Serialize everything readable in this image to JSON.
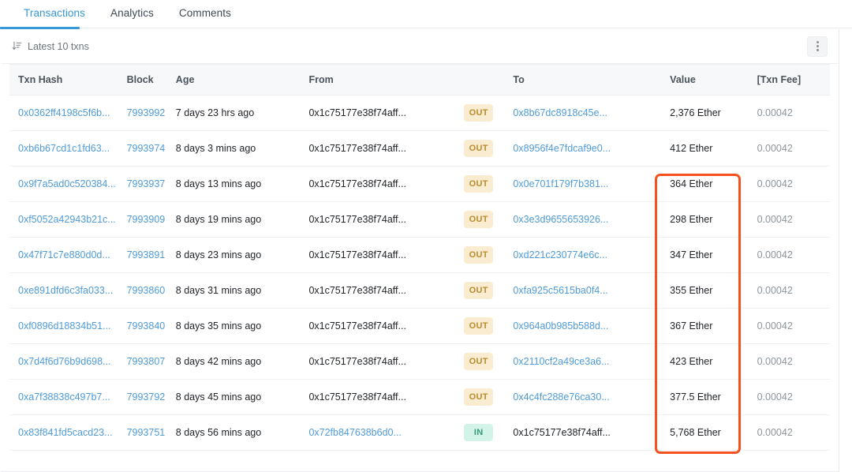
{
  "tabs": [
    {
      "label": "Transactions",
      "active": true
    },
    {
      "label": "Analytics",
      "active": false
    },
    {
      "label": "Comments",
      "active": false
    }
  ],
  "card_header": {
    "sort_icon": "sort-descending-icon",
    "latest_label": "Latest 10 txns",
    "menu_icon": "kebab-menu-icon"
  },
  "table": {
    "columns": [
      "Txn Hash",
      "Block",
      "Age",
      "From",
      "",
      "To",
      "Value",
      "[Txn Fee]"
    ],
    "rows": [
      {
        "hash": "0x0362ff4198c5f6b...",
        "block": "7993992",
        "age": "7 days 23 hrs ago",
        "from": "0x1c75177e38f74aff...",
        "direction": "OUT",
        "to": "0x8b67dc8918c45e...",
        "value": "2,376 Ether",
        "fee": "0.00042",
        "from_is_link": false,
        "to_is_link": true,
        "highlighted": false
      },
      {
        "hash": "0xb6b67cd1c1fd63...",
        "block": "7993974",
        "age": "8 days 3 mins ago",
        "from": "0x1c75177e38f74aff...",
        "direction": "OUT",
        "to": "0x8956f4e7fdcaf9e0...",
        "value": "412 Ether",
        "fee": "0.00042",
        "from_is_link": false,
        "to_is_link": true,
        "highlighted": true
      },
      {
        "hash": "0x9f7a5ad0c520384...",
        "block": "7993937",
        "age": "8 days 13 mins ago",
        "from": "0x1c75177e38f74aff...",
        "direction": "OUT",
        "to": "0x0e701f179f7b381...",
        "value": "364 Ether",
        "fee": "0.00042",
        "from_is_link": false,
        "to_is_link": true,
        "highlighted": true
      },
      {
        "hash": "0xf5052a42943b21c...",
        "block": "7993909",
        "age": "8 days 19 mins ago",
        "from": "0x1c75177e38f74aff...",
        "direction": "OUT",
        "to": "0x3e3d9655653926...",
        "value": "298 Ether",
        "fee": "0.00042",
        "from_is_link": false,
        "to_is_link": true,
        "highlighted": true
      },
      {
        "hash": "0x47f71c7e880d0d...",
        "block": "7993891",
        "age": "8 days 23 mins ago",
        "from": "0x1c75177e38f74aff...",
        "direction": "OUT",
        "to": "0xd221c230774e6c...",
        "value": "347 Ether",
        "fee": "0.00042",
        "from_is_link": false,
        "to_is_link": true,
        "highlighted": true
      },
      {
        "hash": "0xe891dfd6c3fa033...",
        "block": "7993860",
        "age": "8 days 31 mins ago",
        "from": "0x1c75177e38f74aff...",
        "direction": "OUT",
        "to": "0xfa925c5615ba0f4...",
        "value": "355 Ether",
        "fee": "0.00042",
        "from_is_link": false,
        "to_is_link": true,
        "highlighted": true
      },
      {
        "hash": "0xf0896d18834b51...",
        "block": "7993840",
        "age": "8 days 35 mins ago",
        "from": "0x1c75177e38f74aff...",
        "direction": "OUT",
        "to": "0x964a0b985b588d...",
        "value": "367 Ether",
        "fee": "0.00042",
        "from_is_link": false,
        "to_is_link": true,
        "highlighted": true
      },
      {
        "hash": "0x7d4f6d76b9d698...",
        "block": "7993807",
        "age": "8 days 42 mins ago",
        "from": "0x1c75177e38f74aff...",
        "direction": "OUT",
        "to": "0x2110cf2a49ce3a6...",
        "value": "423 Ether",
        "fee": "0.00042",
        "from_is_link": false,
        "to_is_link": true,
        "highlighted": true
      },
      {
        "hash": "0xa7f38838c497b7...",
        "block": "7993792",
        "age": "8 days 45 mins ago",
        "from": "0x1c75177e38f74aff...",
        "direction": "OUT",
        "to": "0x4c4fc288e76ca30...",
        "value": "377.5 Ether",
        "fee": "0.00042",
        "from_is_link": false,
        "to_is_link": true,
        "highlighted": true
      },
      {
        "hash": "0x83f841fd5cacd23...",
        "block": "7993751",
        "age": "8 days 56 mins ago",
        "from": "0x72fb847638b6d0...",
        "direction": "IN",
        "to": "0x1c75177e38f74aff...",
        "value": "5,768 Ether",
        "fee": "0.00042",
        "from_is_link": true,
        "to_is_link": false,
        "highlighted": false
      }
    ]
  },
  "annotation": {
    "name": "value-column-highlight",
    "color": "#f4511e"
  },
  "colors": {
    "accent": "#3498db",
    "link": "#4f9bd9",
    "badge_out_bg": "#faecd0",
    "badge_out_text": "#bb8b2d",
    "badge_in_bg": "#d3f3e8",
    "badge_in_text": "#3a9b7c",
    "header_bg": "#f7f8fa",
    "annotation": "#f4511e"
  }
}
